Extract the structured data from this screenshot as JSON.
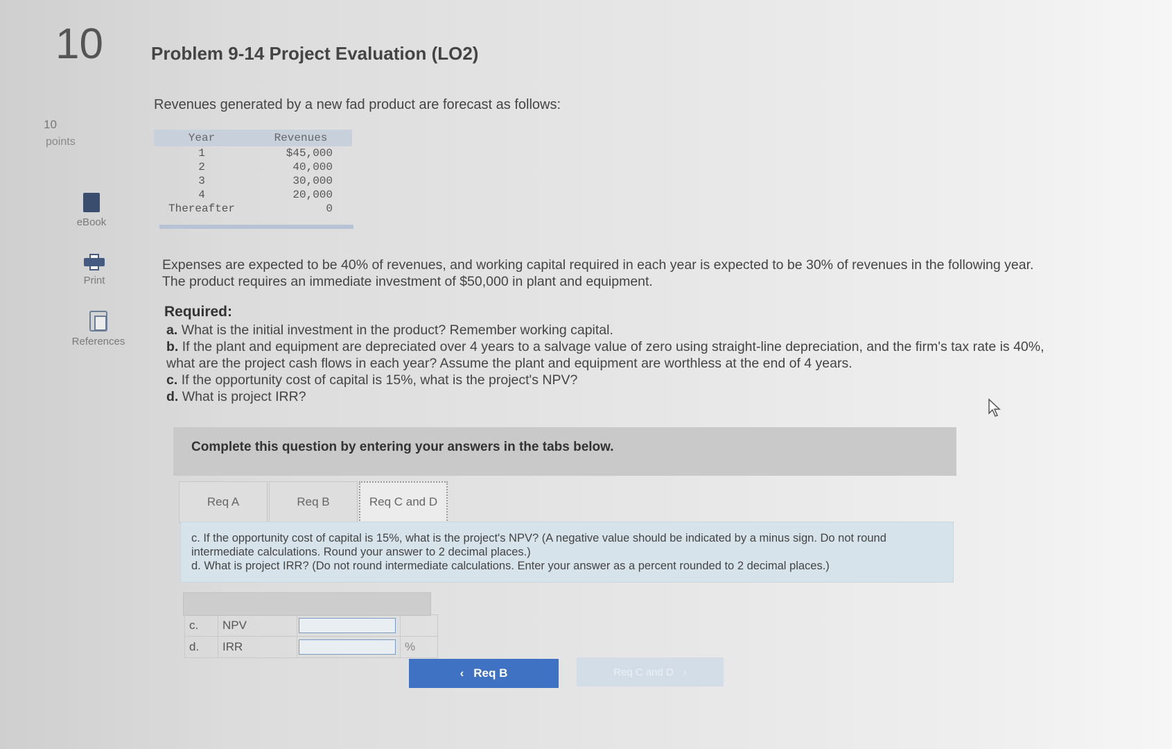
{
  "question_number": "10",
  "title": "Problem 9-14 Project Evaluation (LO2)",
  "points_value": "10",
  "points_label": "points",
  "sidebar": {
    "items": [
      {
        "label": "eBook",
        "icon": "ebook-icon"
      },
      {
        "label": "Print",
        "icon": "print-icon"
      },
      {
        "label": "References",
        "icon": "references-icon"
      }
    ]
  },
  "intro": "Revenues generated by a new fad product are forecast as follows:",
  "revenue_table": {
    "headers": [
      "Year",
      "Revenues"
    ],
    "rows": [
      [
        "1",
        "$45,000"
      ],
      [
        "2",
        "40,000"
      ],
      [
        "3",
        "30,000"
      ],
      [
        "4",
        "20,000"
      ],
      [
        "Thereafter",
        "0"
      ]
    ]
  },
  "description": "Expenses are expected to be 40% of revenues, and working capital required in each year is expected to be 30% of revenues in the following year. The product requires an immediate investment of $50,000 in plant and equipment.",
  "required": {
    "heading": "Required:",
    "items": [
      {
        "letter": "a.",
        "text": "What is the initial investment in the product? Remember working capital."
      },
      {
        "letter": "b.",
        "text": "If the plant and equipment are depreciated over 4 years to a salvage value of zero using straight-line depreciation, and the firm's tax rate is 40%, what are the project cash flows in each year? Assume the plant  and equipment are worthless at the end of 4 years."
      },
      {
        "letter": "c.",
        "text": "If the opportunity cost of capital is 15%, what is the project's NPV?"
      },
      {
        "letter": "d.",
        "text": "What is project IRR?"
      }
    ]
  },
  "instruction_panel": "Complete this question by entering your answers in the tabs below.",
  "tabs": [
    {
      "label": "Req A"
    },
    {
      "label": "Req B"
    },
    {
      "label": "Req C and D"
    }
  ],
  "active_tab": "Req C and D",
  "question_text": {
    "line1": "c. If the opportunity cost of capital is 15%, what is the project's NPV? (A negative value should be indicated by a minus sign. Do not round intermediate calculations. Round your answer to 2 decimal places.)",
    "line2": "d. What is project IRR? (Do not round intermediate calculations. Enter your answer as a percent rounded to 2 decimal places.)"
  },
  "answers": [
    {
      "letter": "c.",
      "label": "NPV",
      "value": "",
      "unit": ""
    },
    {
      "letter": "d.",
      "label": "IRR",
      "value": "",
      "unit": "%"
    }
  ],
  "nav": {
    "prev_label": "Req B",
    "next_label": "Req C and D"
  }
}
